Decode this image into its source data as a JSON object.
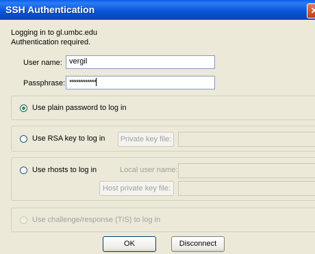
{
  "window": {
    "title": "SSH Authentication",
    "close_glyph": "✕"
  },
  "status": {
    "line1": "Logging in to gl.umbc.edu",
    "line2": "Authentication required."
  },
  "fields": {
    "username_label": "User name:",
    "username_value": "vergil",
    "passphrase_label": "Passphrase:",
    "passphrase_value": "************"
  },
  "options": {
    "plain_password": "Use plain password to log in",
    "rsa_key": "Use RSA key to log in",
    "private_key_file_button": "Private key file:",
    "rhosts": "Use rhosts to log in",
    "local_user_name_label": "Local user name:",
    "host_private_key_file_button": "Host private key file:",
    "challenge_response": "Use challenge/response (TIS) to log in"
  },
  "buttons": {
    "ok": "OK",
    "disconnect": "Disconnect"
  }
}
